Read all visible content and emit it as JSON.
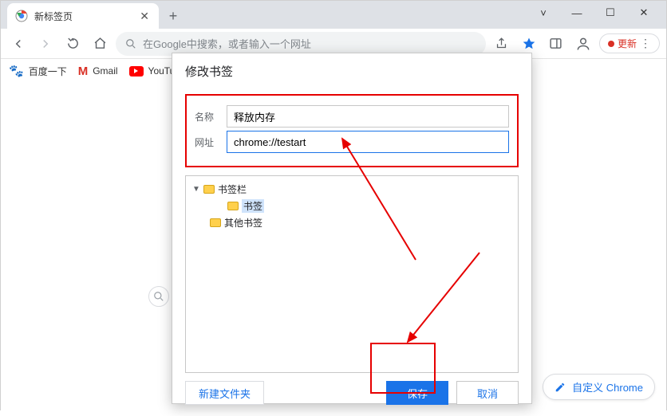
{
  "window": {
    "tab_title": "新标签页",
    "minimize": "—",
    "maximize": "☐",
    "close": "✕"
  },
  "toolbar": {
    "omnibox_placeholder": "在Google中搜索，或者输入一个网址",
    "update_label": "更新"
  },
  "bookmarks_bar": {
    "items": [
      "百度一下",
      "Gmail",
      "YouTu..."
    ]
  },
  "dialog": {
    "title": "修改书签",
    "name_label": "名称",
    "name_value": "释放内存",
    "url_label": "网址",
    "url_value": "chrome://testart",
    "tree": {
      "root": "书签栏",
      "child": "书签",
      "other": "其他书签"
    },
    "new_folder": "新建文件夹",
    "save": "保存",
    "cancel": "取消"
  },
  "content": {
    "customize": "自定义 Chrome"
  }
}
